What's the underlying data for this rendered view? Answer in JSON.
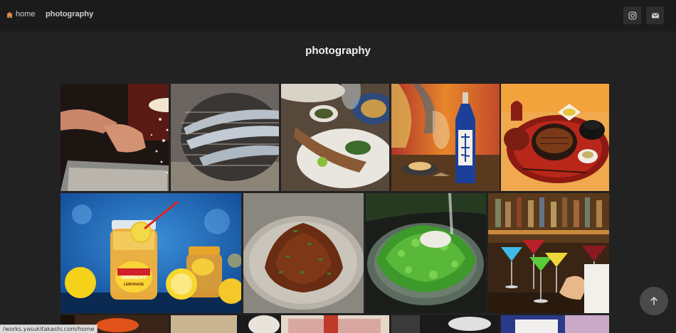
{
  "nav": {
    "home_label": "home",
    "photography_label": "photography",
    "icons": [
      "house-icon",
      "instagram-icon",
      "mail-icon"
    ]
  },
  "page": {
    "title": "photography"
  },
  "gallery": {
    "rows": [
      [
        "rice-seasoning",
        "grilled-sanma",
        "fish-dish-with-sake-glass",
        "sake-bottle-with-glass",
        "unagi-jubako-set"
      ],
      [
        "smirnoff-lemonade-jars",
        "fried-rice-plate",
        "green-salad-plate",
        "bar-cocktails"
      ],
      [
        "partial-photo-1",
        "partial-photo-2",
        "partial-photo-3",
        "partial-photo-4",
        "partial-photo-5",
        "partial-photo-6"
      ]
    ],
    "text_in_photos": {
      "jar_brand": "SMIRNOFF",
      "jar_label": "LEMONADE"
    }
  },
  "status_bar": {
    "url": "/works.yasukitakashi.com/home"
  },
  "colors": {
    "background": "#222222",
    "topbar": "#1b1b1b",
    "button": "#2e2e2e",
    "scroll_button": "#4a4a4a"
  }
}
